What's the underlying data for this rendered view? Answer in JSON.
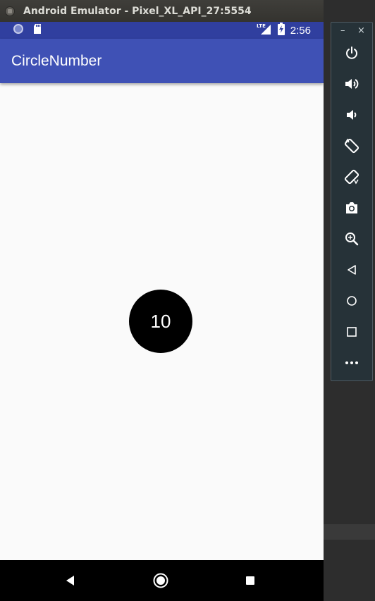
{
  "window": {
    "title": "Android Emulator - Pixel_XL_API_27:5554"
  },
  "status_bar": {
    "time": "2:56",
    "network_label": "LTE",
    "icons": [
      "sync-icon",
      "sd-card-icon",
      "lte-signal-icon",
      "battery-charging-icon"
    ]
  },
  "app_bar": {
    "title": "CircleNumber"
  },
  "content": {
    "circle_number": "10"
  },
  "nav_bar": {
    "icons": [
      "back-icon",
      "home-icon",
      "recents-icon"
    ]
  },
  "toolbar": {
    "minimize_label": "–",
    "close_label": "×",
    "buttons": [
      "power-icon",
      "volume-up-icon",
      "volume-down-icon",
      "rotate-left-icon",
      "rotate-right-icon",
      "camera-icon",
      "zoom-icon",
      "back-icon",
      "home-icon",
      "overview-icon",
      "more-icon"
    ]
  },
  "colors": {
    "status_bar": "#303f9f",
    "app_bar": "#3f51b5",
    "background": "#fafafa",
    "circle": "#000000",
    "toolbar": "#263238"
  }
}
